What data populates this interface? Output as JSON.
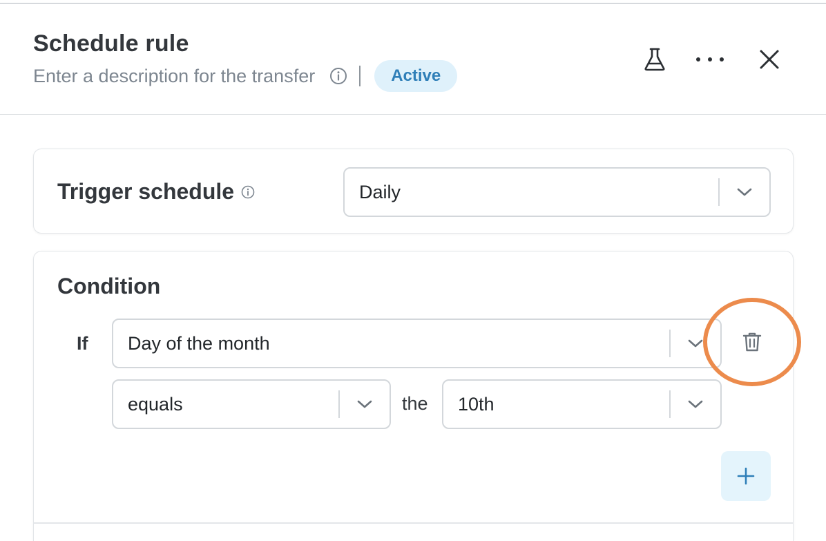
{
  "header": {
    "title": "Schedule rule",
    "description": "Enter a description for the transfer",
    "status_badge": "Active"
  },
  "icons": {
    "info": "info-circle-icon",
    "test": "flask-icon",
    "more": "more-horizontal-icon",
    "close": "close-icon",
    "delete": "trash-icon",
    "add": "plus-icon",
    "dropdown": "chevron-down-icon"
  },
  "trigger": {
    "label": "Trigger schedule",
    "value": "Daily"
  },
  "condition": {
    "title": "Condition",
    "if_label": "If",
    "field": "Day of the month",
    "operator": "equals",
    "connector": "the",
    "operand": "10th"
  },
  "colors": {
    "accent": "#2f7fb8",
    "badge_bg": "#dff1fb",
    "highlight": "#ec8b4c"
  }
}
